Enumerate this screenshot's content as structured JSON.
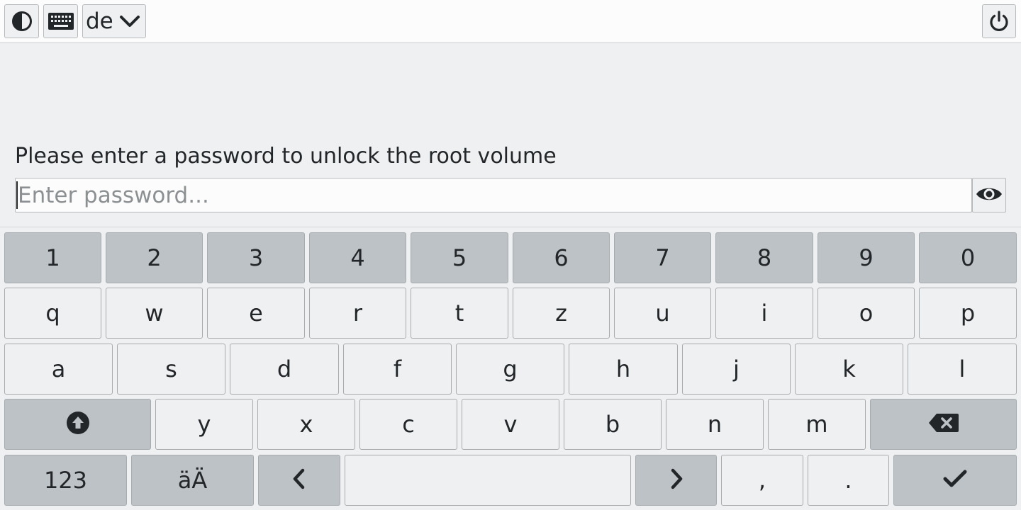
{
  "topbar": {
    "contrast_icon": "contrast-icon",
    "keyboard_icon": "keyboard-icon",
    "language": "de",
    "language_icon": "chevron-down-icon",
    "power_icon": "power-icon"
  },
  "unlock": {
    "prompt": "Please enter a password to unlock the root volume",
    "password_placeholder": "Enter password...",
    "password_value": "",
    "reveal_icon": "eye-icon"
  },
  "keyboard": {
    "rows": [
      [
        "1",
        "2",
        "3",
        "4",
        "5",
        "6",
        "7",
        "8",
        "9",
        "0"
      ],
      [
        "q",
        "w",
        "e",
        "r",
        "t",
        "z",
        "u",
        "i",
        "o",
        "p"
      ],
      [
        "a",
        "s",
        "d",
        "f",
        "g",
        "h",
        "j",
        "k",
        "l"
      ],
      [
        "y",
        "x",
        "c",
        "v",
        "b",
        "n",
        "m"
      ]
    ],
    "numbers_label": "123",
    "umlaut_label": "äÄ",
    "comma_label": ",",
    "period_label": ".",
    "shift_icon": "shift-icon",
    "backspace_icon": "backspace-icon",
    "left_icon": "chevron-left-icon",
    "right_icon": "chevron-right-icon",
    "enter_icon": "check-icon"
  },
  "colors": {
    "background": "#eff0f1",
    "topbar": "#fcfcfc",
    "key_light": "#eff0f1",
    "key_dark": "#bdc2c6",
    "text": "#232629"
  }
}
